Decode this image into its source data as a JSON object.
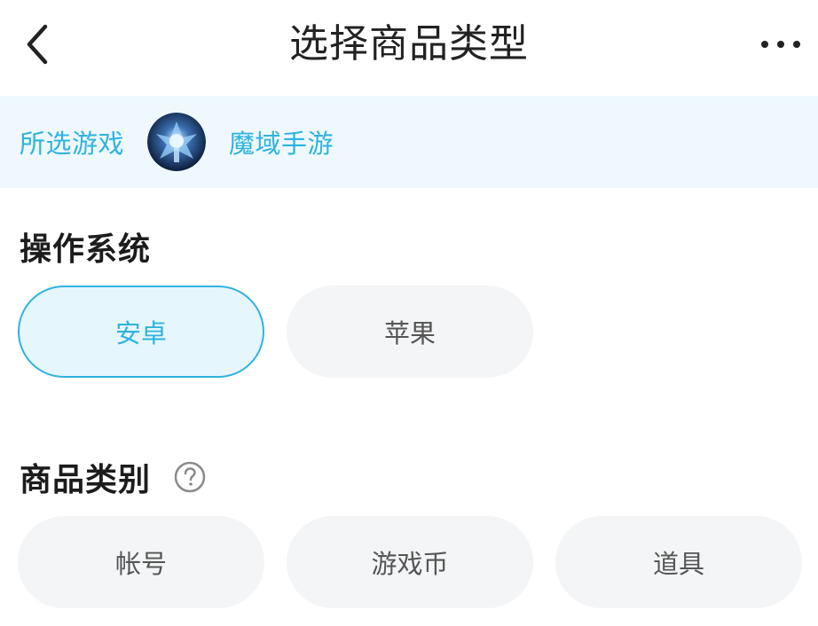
{
  "header": {
    "title": "选择商品类型"
  },
  "banner": {
    "label": "所选游戏",
    "game_name": "魔域手游"
  },
  "os_section": {
    "title": "操作系统",
    "options": [
      {
        "label": "安卓",
        "selected": true
      },
      {
        "label": "苹果",
        "selected": false
      }
    ]
  },
  "category_section": {
    "title": "商品类别",
    "options": [
      {
        "label": "帐号",
        "selected": false
      },
      {
        "label": "游戏币",
        "selected": false
      },
      {
        "label": "道具",
        "selected": false
      }
    ]
  },
  "icons": {
    "back": "chevron-left-icon",
    "more": "more-horizontal-icon",
    "help": "question-circle-icon"
  },
  "colors": {
    "accent": "#2fb3df",
    "banner_bg": "#eef8fd",
    "chip_bg": "#f4f5f7",
    "chip_selected_bg": "#e6f6fd"
  }
}
